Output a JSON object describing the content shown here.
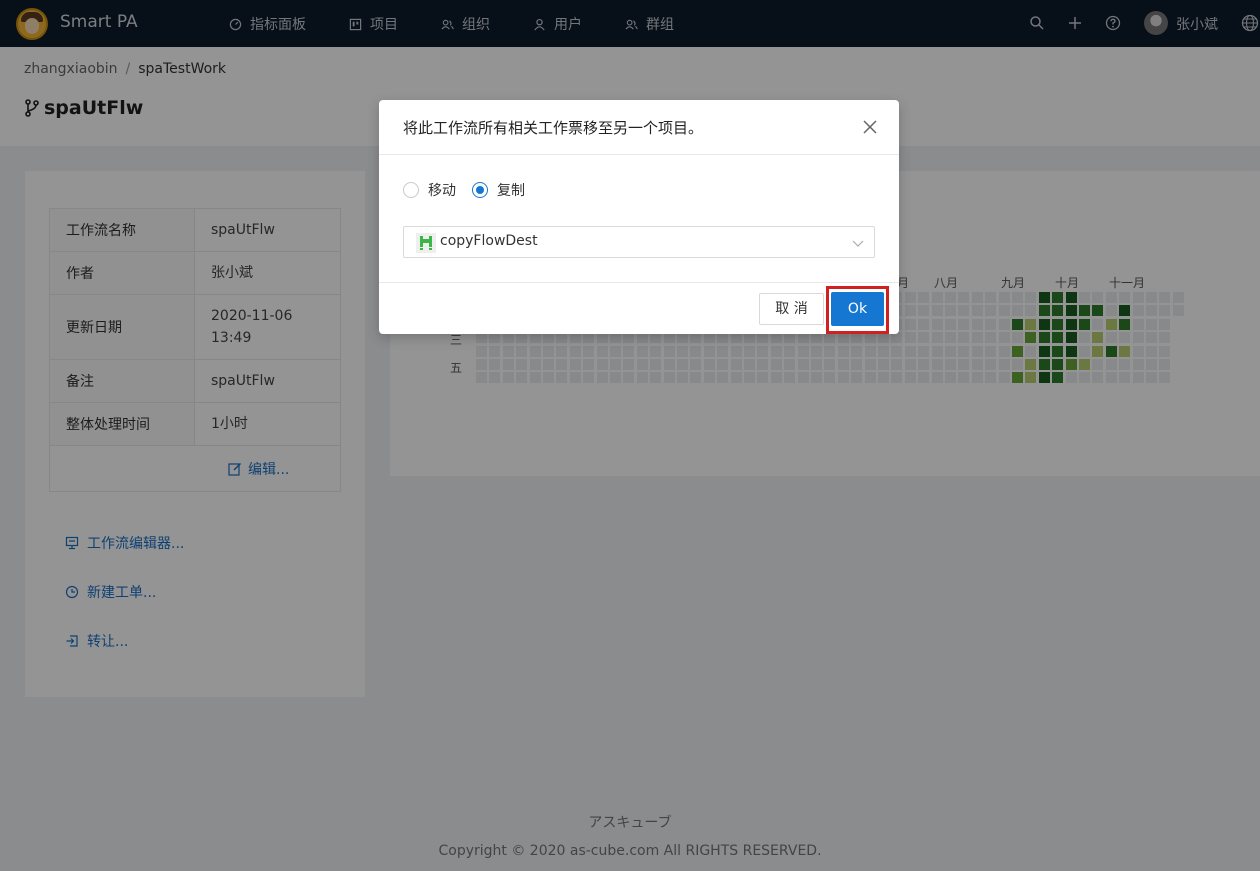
{
  "topbar": {
    "app_name": "Smart PA",
    "nav": [
      {
        "label": "指标面板",
        "icon": "dashboard-icon"
      },
      {
        "label": "项目",
        "icon": "project-icon"
      },
      {
        "label": "组织",
        "icon": "org-icon"
      },
      {
        "label": "用户",
        "icon": "user-icon"
      },
      {
        "label": "群组",
        "icon": "group-icon"
      }
    ],
    "user_name": "张小斌"
  },
  "breadcrumb": {
    "parent": "zhangxiaobin",
    "separator": "/",
    "current": "spaTestWork"
  },
  "page_title": "spaUtFlw",
  "info": {
    "rows": [
      {
        "key": "工作流名称",
        "value": "spaUtFlw"
      },
      {
        "key": "作者",
        "value": "张小斌"
      },
      {
        "key": "更新日期",
        "value": "2020-11-06 13:49"
      },
      {
        "key": "备注",
        "value": "spaUtFlw"
      },
      {
        "key": "整体处理时间",
        "value": "1小时"
      }
    ],
    "edit_label": "编辑..."
  },
  "side_links": {
    "editor": "工作流编辑器...",
    "new_ticket": "新建工单...",
    "transfer": "转让..."
  },
  "heatmap": {
    "months": [
      "八月",
      "九月",
      "十月",
      "十一月"
    ],
    "partial_month": "月",
    "days": [
      "三",
      "五"
    ],
    "colors": {
      "empty": "#ebedf0",
      "l1": "#b8cf73",
      "l2": "#6aa83a",
      "l3": "#2d7d2a",
      "l4": "#1a5e1f"
    }
  },
  "modal": {
    "title": "将此工作流所有相关工作票移至另一个项目。",
    "radio_move": "移动",
    "radio_copy": "复制",
    "selected_radio": "copy",
    "select_value": "copyFlowDest",
    "cancel_label": "取 消",
    "ok_label": "Ok"
  },
  "footer": {
    "line1": "アスキューブ",
    "line2": "Copyright © 2020 as-cube.com All RIGHTS RESERVED."
  }
}
